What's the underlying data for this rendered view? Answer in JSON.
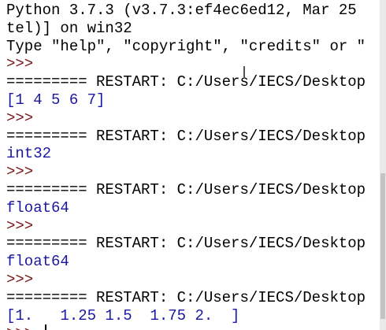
{
  "shell": {
    "header": {
      "line1": "Python 3.7.3 (v3.7.3:ef4ec6ed12, Mar 25",
      "line2": "tel)] on win32",
      "line3": "Type \"help\", \"copyright\", \"credits\" or \""
    },
    "prompt": ">>>",
    "restart_line": "========= RESTART: C:/Users/IECS/Desktop",
    "outputs": {
      "out1": "[1 4 5 6 7]",
      "out2": "int32",
      "out3": "float64",
      "out4": "float64",
      "out5": "[1.   1.25 1.5  1.75 2.  ]"
    }
  },
  "colors": {
    "prompt": "#7a1515",
    "output": "#1c17a0",
    "text": "#000000"
  }
}
